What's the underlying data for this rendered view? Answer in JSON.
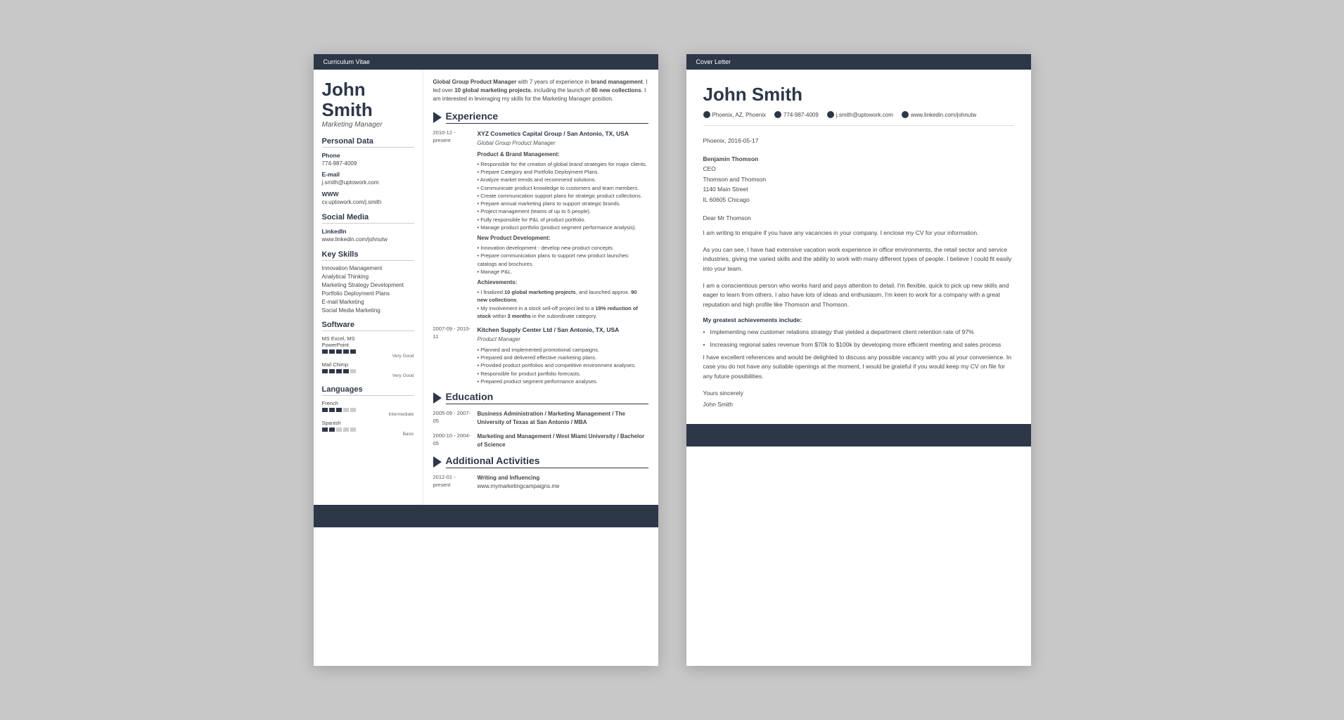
{
  "cv": {
    "header_bar": "Curriculum Vitae",
    "name": "John Smith",
    "title": "Marketing Manager",
    "sidebar": {
      "personal_data_title": "Personal Data",
      "phone_label": "Phone",
      "phone_value": "774-987-4009",
      "email_label": "E-mail",
      "email_value": "j.smith@uptowork.com",
      "www_label": "WWW",
      "www_value": "cv.uptowork.com/j.smith",
      "social_media_title": "Social Media",
      "linkedin_label": "LinkedIn",
      "linkedin_value": "www.linkedin.com/johnutw",
      "key_skills_title": "Key Skills",
      "skills": [
        "Innovation Management",
        "Analytical Thinking",
        "Marketing Strategy Development",
        "Portfolio Deployment Plans",
        "E-mail Marketing",
        "Social Media Marketing"
      ],
      "software_title": "Software",
      "software": [
        {
          "name": "MS Excel, MS PowerPoint",
          "dots": 5,
          "rating": "Very Good"
        },
        {
          "name": "Mail Chimp",
          "dots": 4,
          "rating": "Very Good"
        }
      ],
      "languages_title": "Languages",
      "languages": [
        {
          "name": "French",
          "dots": 3,
          "rating": "Intermediate"
        },
        {
          "name": "Spanish",
          "dots": 2,
          "rating": "Basic"
        }
      ]
    },
    "intro": "Global Group Product Manager with 7 years of experience in brand management. I led over 10 global marketing projects, including the launch of 60 new collections. I am interested in leveraging my skills for the Marketing Manager position.",
    "experience_title": "Experience",
    "experience": [
      {
        "date": "2010-12 - present",
        "company": "XYZ Cosmetics Capital Group / San Antonio, TX, USA",
        "role": "Global Group Product Manager",
        "sections": [
          {
            "title": "Product & Brand Management:",
            "bullets": [
              "Responsible for the creation of global brand strategies for major clients.",
              "Prepare Category and Portfolio Deployment Plans.",
              "Analyze market trends and recommend solutions.",
              "Communicate product knowledge to customers and team members.",
              "Create communication support plans for strategic product collections.",
              "Prepare annual marketing plans to support strategic brands.",
              "Project management (teams of up to 5 people).",
              "Fully responsible for P&L of product portfolio.",
              "Manage product portfolio (product segment performance analysis)."
            ]
          },
          {
            "title": "New Product Development:",
            "bullets": [
              "Innovation development - develop new product concepts.",
              "Prepare communication plans to support new product launches: catalogs and brochures.",
              "Manage P&L."
            ]
          },
          {
            "title": "Achievements:",
            "bullets": [
              "I finalized 10 global marketing projects, and launched approx. 90 new collections.",
              "My involvement in a stock sell-off project led to a 19% reduction of stock within 3 months in the subordinate category."
            ]
          }
        ]
      },
      {
        "date": "2007-09 - 2010-11",
        "company": "Kitchen Supply Center Ltd / San Antonio, TX, USA",
        "role": "Product Manager",
        "bullets": [
          "Planned and implemented promotional campaigns.",
          "Prepared and delivered effective marketing plans.",
          "Provided product portfolios and competitive environment analyses.",
          "Responsible for product portfolio forecasts.",
          "Prepared product segment performance analyses."
        ]
      }
    ],
    "education_title": "Education",
    "education": [
      {
        "date": "2005-09 - 2007-05",
        "title": "Business Administration / Marketing Management / The University of Texas at San Antonio / MBA"
      },
      {
        "date": "2000-10 - 2004-05",
        "title": "Marketing and Management / West Miami University / Bachelor of Science"
      }
    ],
    "activities_title": "Additional Activities",
    "activities": [
      {
        "date": "2012-01 - present",
        "title": "Writing and Influencing",
        "value": "www.mymarketingcampaigns.me"
      }
    ]
  },
  "cover_letter": {
    "header_bar": "Cover Letter",
    "name": "John Smith",
    "contact": {
      "location": "Phoenix, AZ, Phoenix",
      "phone": "774-987-4009",
      "email": "j.smith@uptowork.com",
      "linkedin": "www.linkedin.com/johnutw"
    },
    "date": "Phoenix, 2016-05-17",
    "recipient": {
      "name": "Benjamin Thomson",
      "title": "CEO",
      "company": "Thomson and Thomson",
      "address1": "1140 Main Street",
      "address2": "IL 60605 Chicago"
    },
    "salutation": "Dear Mr Thomson",
    "paragraphs": [
      "I am writing to enquire if you have any vacancies in your company. I enclose my CV for your information.",
      "As you can see, I have had extensive vacation work experience in office environments, the retail sector and service industries, giving me varied skills and the ability to work with many different types of people. I believe I could fit easily into your team.",
      "I am a conscientious person who works hard and pays attention to detail. I'm flexible, quick to pick up new skills and eager to learn from others. I also have lots of ideas and enthusiasm. I'm keen to work for a company with a great reputation and high profile like Thomson and Thomson."
    ],
    "achievements_title": "My greatest achievements include:",
    "achievements": [
      "Implementing new customer relations strategy that yielded a department client retention rate of 97%",
      "Increasing regional sales revenue from $70k to $100k by developing more efficient meeting and sales process"
    ],
    "closing_paragraph": "I have excellent references and would be delighted to discuss any possible vacancy with you at your convenience. In case you do not have any suitable openings at the moment, I would be grateful if you would keep my CV on file for any future possibilities.",
    "sign_off": "Yours sincerely",
    "signature": "John Smith"
  }
}
